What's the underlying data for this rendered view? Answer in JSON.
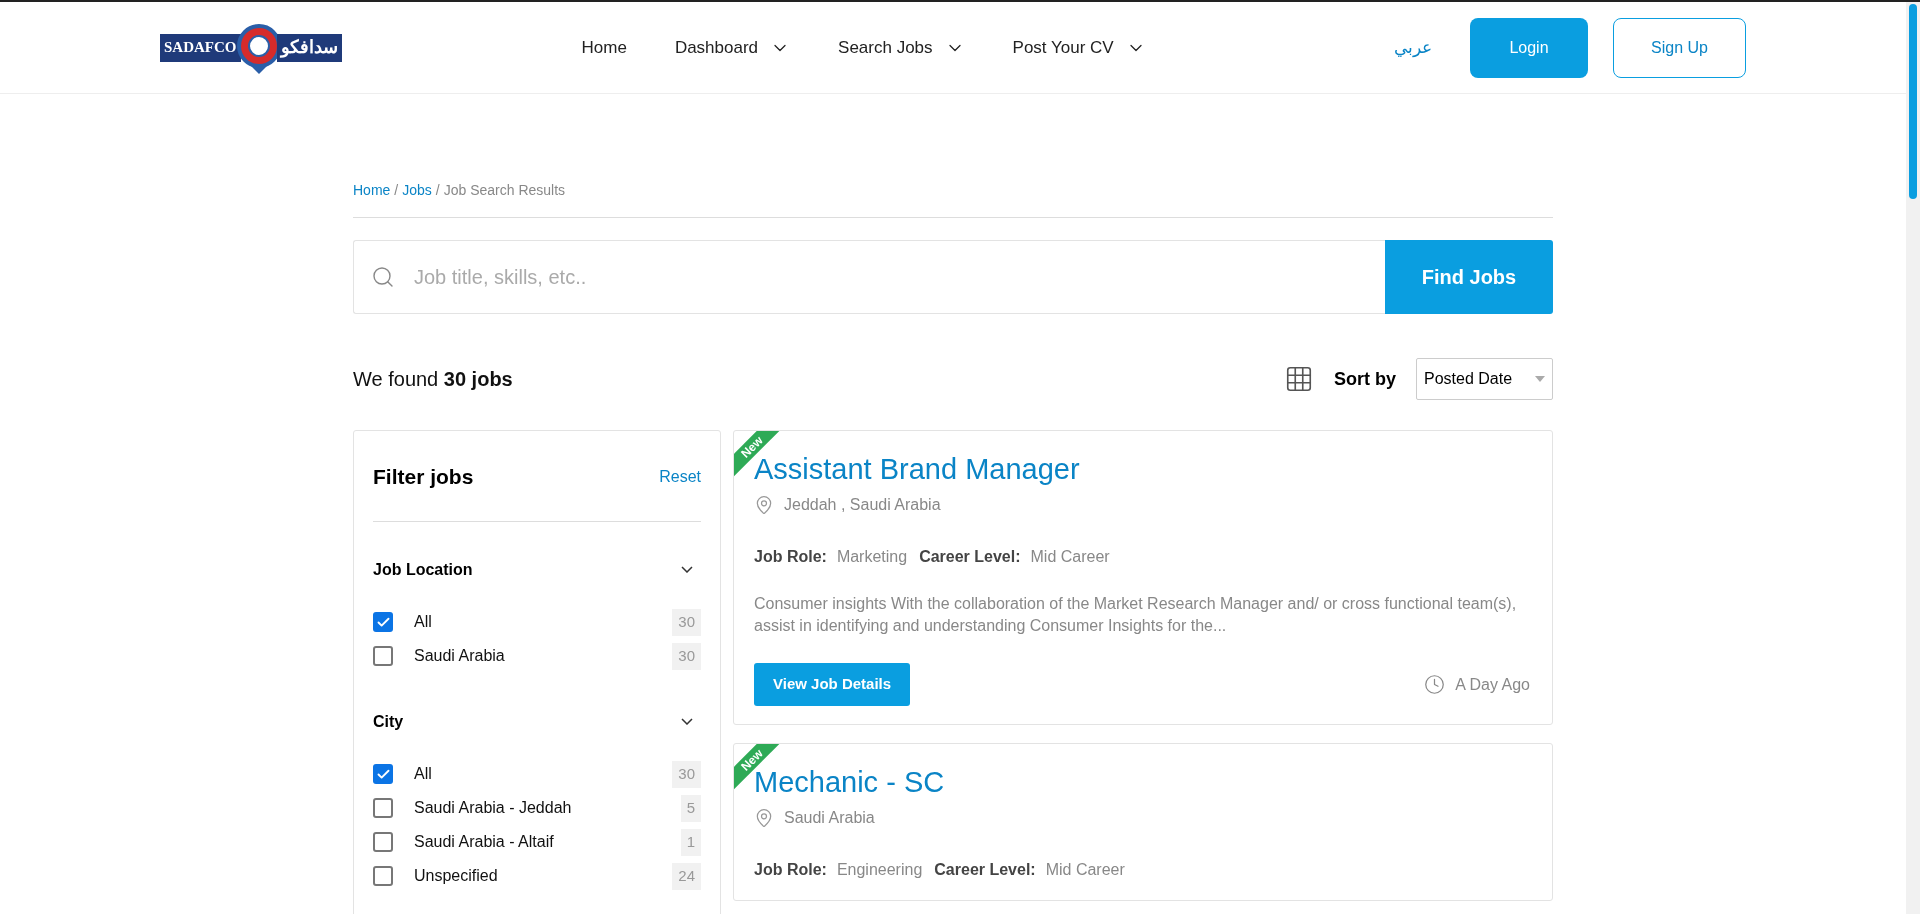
{
  "header": {
    "logo": {
      "latin": "SADAFCO",
      "arabic": "سدافكو"
    },
    "nav": [
      {
        "label": "Home",
        "dropdown": false
      },
      {
        "label": "Dashboard",
        "dropdown": true
      },
      {
        "label": "Search Jobs",
        "dropdown": true
      },
      {
        "label": "Post Your CV",
        "dropdown": true
      }
    ],
    "language": "عربي",
    "login": "Login",
    "signup": "Sign Up"
  },
  "breadcrumb": [
    {
      "kind": "link",
      "label": "Home"
    },
    {
      "kind": "separator",
      "label": "/"
    },
    {
      "kind": "link",
      "label": "Jobs"
    },
    {
      "kind": "separator",
      "label": "/"
    },
    {
      "kind": "current",
      "label": "Job Search Results"
    }
  ],
  "search": {
    "placeholder": "Job title, skills, etc..",
    "button": "Find Jobs"
  },
  "results": {
    "summary": "We found **30 jobs**",
    "sort_label": "Sort by",
    "sort_value": "Posted Date"
  },
  "filters": {
    "title": "Filter jobs",
    "reset": "Reset",
    "groups": [
      {
        "title": "Job Location",
        "expanded": true,
        "options": [
          {
            "label": "All",
            "checked": true,
            "count": "30"
          },
          {
            "label": "Saudi Arabia",
            "checked": false,
            "count": "30"
          }
        ]
      },
      {
        "title": "City",
        "expanded": true,
        "options": [
          {
            "label": "All",
            "checked": true,
            "count": "30"
          },
          {
            "label": "Saudi Arabia - Jeddah",
            "checked": false,
            "count": "5"
          },
          {
            "label": "Saudi Arabia - Altaif",
            "checked": false,
            "count": "1"
          },
          {
            "label": "Unspecified",
            "checked": false,
            "count": "24"
          }
        ]
      }
    ]
  },
  "jobs": [
    {
      "new": true,
      "badge": "New",
      "title": "Assistant Brand Manager",
      "location": "Jeddah , Saudi Arabia",
      "role_label": "Job Role:",
      "role": "Marketing",
      "level_label": "Career Level:",
      "level": "Mid Career",
      "description": "Consumer insights With the collaboration of the Market Research Manager and/ or cross functional team(s), assist in identifying and understanding Consumer Insights for the...",
      "button": "View Job Details",
      "posted": "A Day Ago"
    },
    {
      "new": true,
      "badge": "New",
      "title": "Mechanic - SC",
      "location": "Saudi Arabia",
      "role_label": "Job Role:",
      "role": "Engineering",
      "level_label": "Career Level:",
      "level": "Mid Career"
    }
  ]
}
